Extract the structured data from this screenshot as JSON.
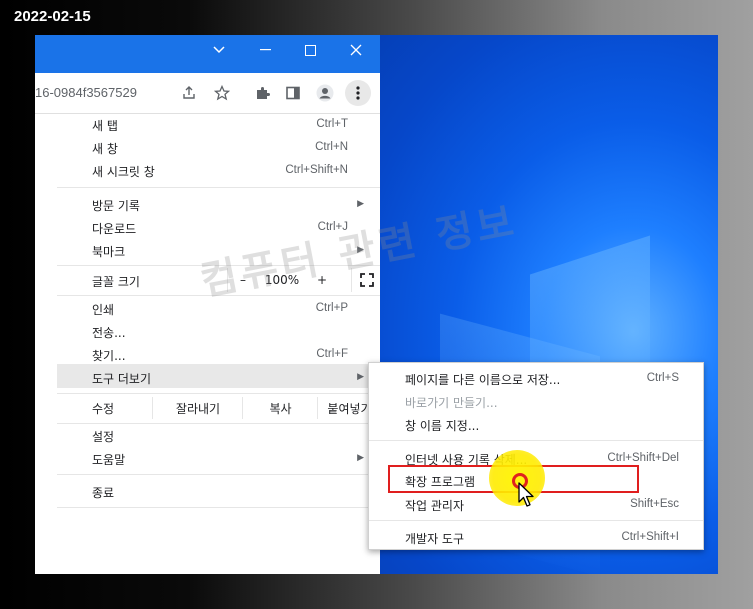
{
  "date_stamp": "2022-02-15",
  "toolbar": {
    "url_fragment": "16-0984f3567529"
  },
  "menu": {
    "new_tab": {
      "label": "새 탭",
      "shortcut": "Ctrl+T"
    },
    "new_window": {
      "label": "새 창",
      "shortcut": "Ctrl+N"
    },
    "incognito": {
      "label": "새 시크릿 창",
      "shortcut": "Ctrl+Shift+N"
    },
    "history": {
      "label": "방문 기록"
    },
    "downloads": {
      "label": "다운로드",
      "shortcut": "Ctrl+J"
    },
    "bookmarks": {
      "label": "북마크"
    },
    "zoom": {
      "label": "글꼴 크기",
      "minus": "–",
      "value": "100%",
      "plus": "+"
    },
    "print": {
      "label": "인쇄",
      "shortcut": "Ctrl+P"
    },
    "cast": {
      "label": "전송..."
    },
    "find": {
      "label": "찾기...",
      "shortcut": "Ctrl+F"
    },
    "more_tools": {
      "label": "도구 더보기"
    },
    "edit": {
      "label": "수정",
      "cut": "잘라내기",
      "copy": "복사",
      "paste": "붙여넣기"
    },
    "settings": {
      "label": "설정"
    },
    "help": {
      "label": "도움말"
    },
    "exit": {
      "label": "종료"
    }
  },
  "submenu": {
    "save_page": {
      "label": "페이지를 다른 이름으로 저장...",
      "shortcut": "Ctrl+S"
    },
    "create_shortcut": {
      "label": "바로가기 만들기..."
    },
    "name_window": {
      "label": "창 이름 지정..."
    },
    "clear_data": {
      "label": "인터넷 사용 기록 삭제...",
      "shortcut": "Ctrl+Shift+Del"
    },
    "extensions": {
      "label": "확장 프로그램"
    },
    "task_manager": {
      "label": "작업 관리자",
      "shortcut": "Shift+Esc"
    },
    "dev_tools": {
      "label": "개발자 도구",
      "shortcut": "Ctrl+Shift+I"
    }
  },
  "watermark": "컴퓨터 관련 정보",
  "colors": {
    "titlebar": "#1a73e8",
    "highlight_box": "#e01e1e",
    "cursor_halo": "#ffeb00"
  }
}
